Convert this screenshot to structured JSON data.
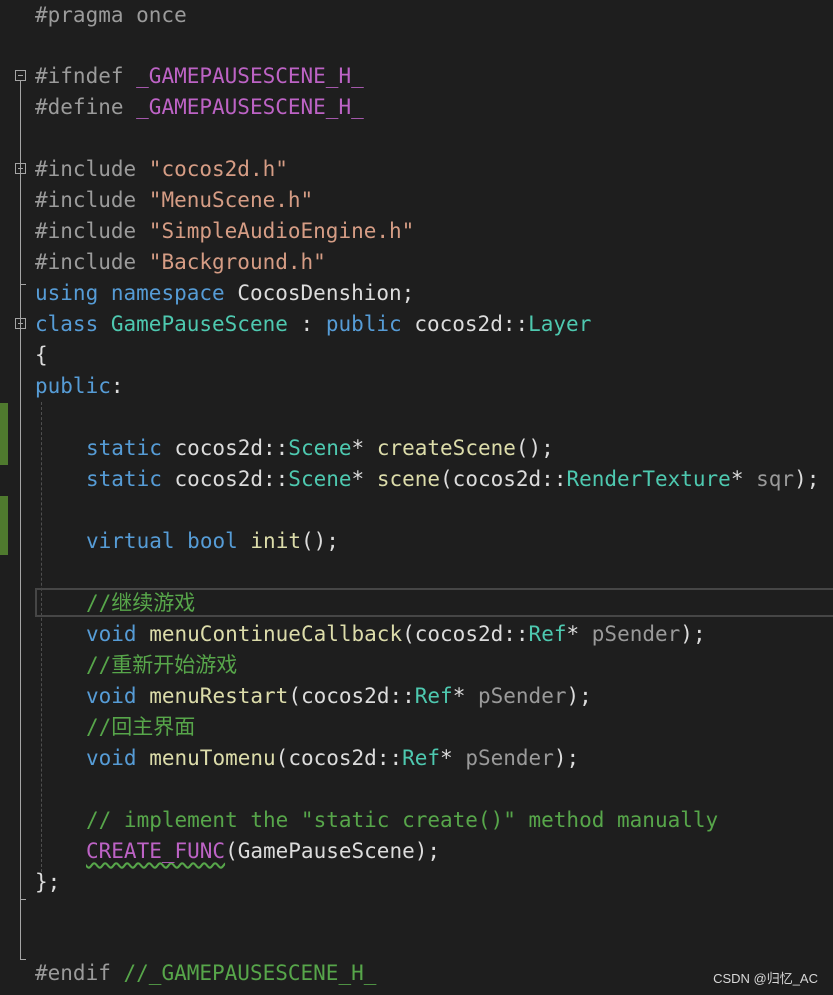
{
  "editor": {
    "lines": {
      "l1": [
        "#pragma once"
      ],
      "l2": [
        "#ifndef ",
        "_GAMEPAUSESCENE_H_"
      ],
      "l3": [
        "#define ",
        "_GAMEPAUSESCENE_H_"
      ],
      "l4": [
        "#include ",
        "\"cocos2d.h\""
      ],
      "l5": [
        "#include ",
        "\"MenuScene.h\""
      ],
      "l6": [
        "#include ",
        "\"SimpleAudioEngine.h\""
      ],
      "l7": [
        "#include ",
        "\"Background.h\""
      ],
      "l8": [
        "using",
        " ",
        "namespace",
        " CocosDenshion;"
      ],
      "l9": [
        "class",
        " ",
        "GamePauseScene",
        " : ",
        "public",
        " cocos2d::",
        "Layer"
      ],
      "l10": [
        "{"
      ],
      "l11": [
        "public",
        ":"
      ],
      "l12": [
        "static",
        " cocos2d::",
        "Scene",
        "* ",
        "createScene",
        "();"
      ],
      "l13": [
        "static",
        " cocos2d::",
        "Scene",
        "* ",
        "scene",
        "(cocos2d::",
        "RenderTexture",
        "* ",
        "sqr",
        ");"
      ],
      "l14": [
        "virtual",
        " ",
        "bool",
        " ",
        "init",
        "();"
      ],
      "l15": [
        "//继续游戏"
      ],
      "l16": [
        "void",
        " ",
        "menuContinueCallback",
        "(cocos2d::",
        "Ref",
        "* ",
        "pSender",
        ");"
      ],
      "l17": [
        "//重新开始游戏"
      ],
      "l18": [
        "void",
        " ",
        "menuRestart",
        "(cocos2d::",
        "Ref",
        "* ",
        "pSender",
        ");"
      ],
      "l19": [
        "//回主界面"
      ],
      "l20": [
        "void",
        " ",
        "menuTomenu",
        "(cocos2d::",
        "Ref",
        "* ",
        "pSender",
        ");"
      ],
      "l21": [
        "// implement the \"static create()\" method manually"
      ],
      "l22": [
        "CREATE_FUNC",
        "(GamePauseScene);"
      ],
      "l23": [
        "};"
      ],
      "l24": [
        "#endif ",
        "//_GAMEPAUSESCENE_H_"
      ]
    }
  },
  "watermark": "CSDN @归忆_AC",
  "colors": {
    "background": "#1e1e1e",
    "preprocessor": "#9b9b9b",
    "macro": "#bd63c5",
    "string": "#d69d85",
    "keyword": "#569cd6",
    "type": "#4ec9b0",
    "function": "#dcdcaa",
    "comment": "#57a64a",
    "parameter": "#9a9a9a",
    "text": "#dcdcdc",
    "change_bar": "#4f7a2e"
  },
  "icons": [
    "fold-collapse-icon"
  ]
}
